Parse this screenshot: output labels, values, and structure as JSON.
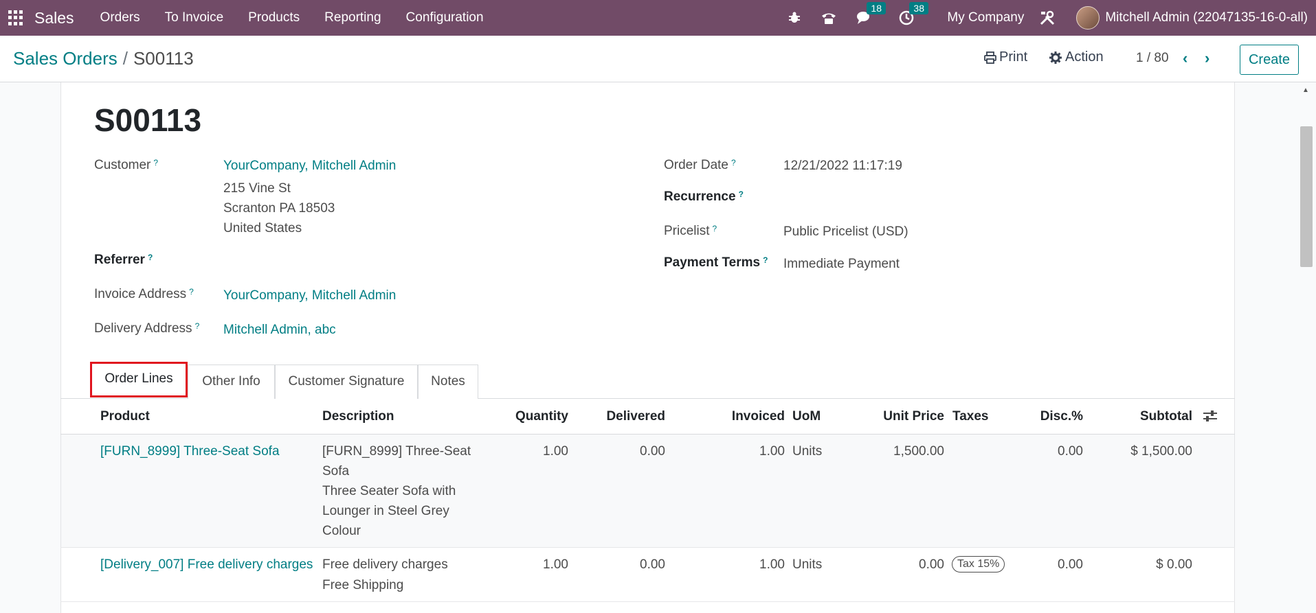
{
  "navbar": {
    "app_name": "Sales",
    "menu": [
      "Orders",
      "To Invoice",
      "Products",
      "Reporting",
      "Configuration"
    ],
    "messages_count": "18",
    "activities_count": "38",
    "company": "My Company",
    "user": "Mitchell Admin (22047135-16-0-all)"
  },
  "control": {
    "breadcrumb_parent": "Sales Orders",
    "breadcrumb_sep": "/",
    "breadcrumb_current": "S00113",
    "print_label": "Print",
    "action_label": "Action",
    "pager": "1 / 80",
    "create_label": "Create"
  },
  "form": {
    "title": "S00113",
    "customer_label": "Customer",
    "customer_name": "YourCompany, Mitchell Admin",
    "customer_address": [
      "215 Vine St",
      "Scranton PA 18503",
      "United States"
    ],
    "referrer_label": "Referrer",
    "invoice_address_label": "Invoice Address",
    "invoice_address": "YourCompany, Mitchell Admin",
    "delivery_address_label": "Delivery Address",
    "delivery_address": "Mitchell Admin, abc",
    "order_date_label": "Order Date",
    "order_date": "12/21/2022 11:17:19",
    "recurrence_label": "Recurrence",
    "pricelist_label": "Pricelist",
    "pricelist": "Public Pricelist (USD)",
    "payment_terms_label": "Payment Terms",
    "payment_terms": "Immediate Payment",
    "help_mark": "?"
  },
  "tabs": [
    "Order Lines",
    "Other Info",
    "Customer Signature",
    "Notes"
  ],
  "table": {
    "headers": [
      "Product",
      "Description",
      "Quantity",
      "Delivered",
      "Invoiced",
      "UoM",
      "Unit Price",
      "Taxes",
      "Disc.%",
      "Subtotal"
    ],
    "rows": [
      {
        "product": "[FURN_8999] Three-Seat Sofa",
        "description": [
          "[FURN_8999] Three-Seat",
          "Sofa",
          "Three Seater Sofa with",
          "Lounger in Steel Grey",
          "Colour"
        ],
        "quantity": "1.00",
        "delivered": "0.00",
        "invoiced": "1.00",
        "uom": "Units",
        "unit_price": "1,500.00",
        "taxes": "",
        "discount": "0.00",
        "subtotal": "$ 1,500.00"
      },
      {
        "product": "[Delivery_007] Free delivery charges",
        "description": [
          "Free delivery charges",
          "Free Shipping"
        ],
        "quantity": "1.00",
        "delivered": "0.00",
        "invoiced": "1.00",
        "uom": "Units",
        "unit_price": "0.00",
        "taxes": "Tax 15%",
        "discount": "0.00",
        "subtotal": "$ 0.00"
      }
    ]
  },
  "colors": {
    "brand": "#714b67",
    "link": "#017e84",
    "highlight": "#e0141e"
  }
}
